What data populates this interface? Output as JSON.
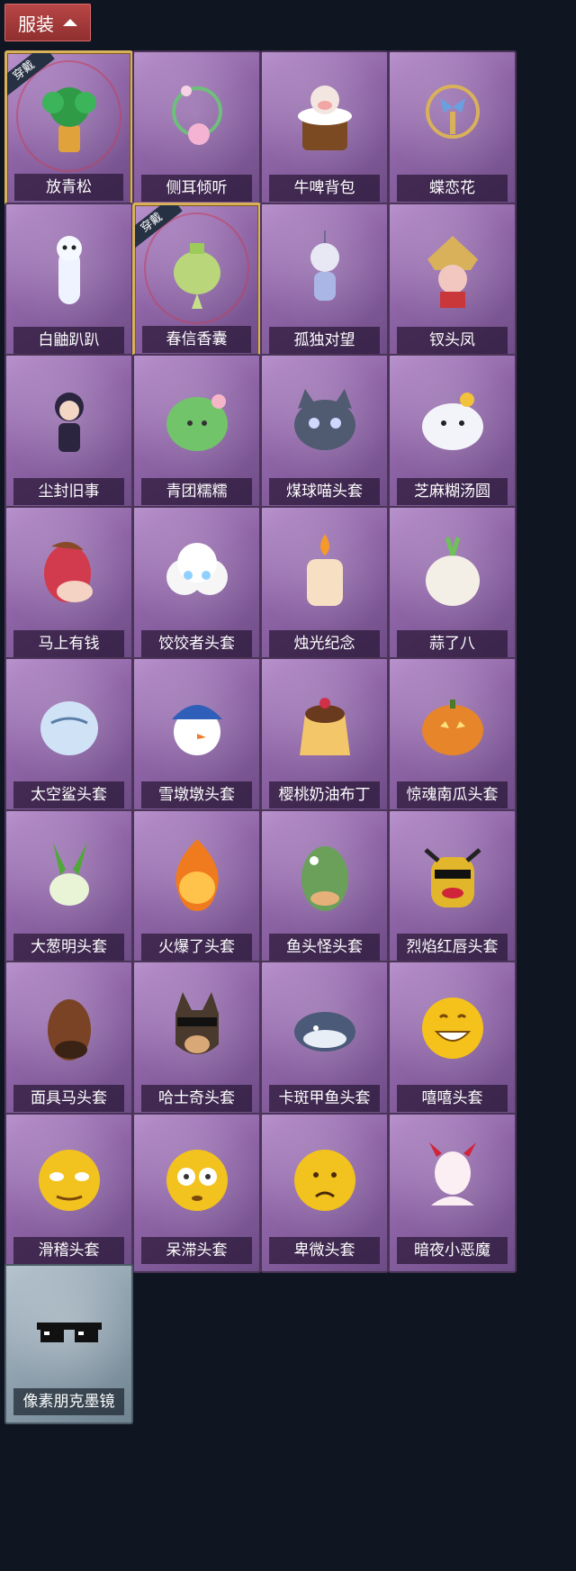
{
  "header": {
    "title": "服装"
  },
  "worn_tag_text": "穿戴",
  "items": [
    {
      "label": "放青松",
      "icon": "potted-pine-icon",
      "worn": true
    },
    {
      "label": "侧耳倾听",
      "icon": "floral-ear-ornament-icon",
      "worn": false
    },
    {
      "label": "牛啤背包",
      "icon": "cow-beer-backpack-icon",
      "worn": false
    },
    {
      "label": "蝶恋花",
      "icon": "butterfly-flower-ornament-icon",
      "worn": false
    },
    {
      "label": "白鼬趴趴",
      "icon": "white-ermine-icon",
      "worn": false
    },
    {
      "label": "春信香囊",
      "icon": "sachet-icon",
      "worn": true
    },
    {
      "label": "孤独对望",
      "icon": "doll-charm-icon",
      "worn": false
    },
    {
      "label": "钗头凤",
      "icon": "phoenix-crown-icon",
      "worn": false
    },
    {
      "label": "尘封旧事",
      "icon": "chibi-figure-icon",
      "worn": false
    },
    {
      "label": "青团糯糯",
      "icon": "green-rice-ball-icon",
      "worn": false
    },
    {
      "label": "煤球喵头套",
      "icon": "black-cat-head-icon",
      "worn": false
    },
    {
      "label": "芝麻糊汤圆",
      "icon": "dumpling-head-icon",
      "worn": false
    },
    {
      "label": "马上有钱",
      "icon": "red-horse-head-icon",
      "worn": false
    },
    {
      "label": "饺饺者头套",
      "icon": "cloud-dumpling-head-icon",
      "worn": false
    },
    {
      "label": "烛光纪念",
      "icon": "candle-head-icon",
      "worn": false
    },
    {
      "label": "蒜了八",
      "icon": "garlic-head-icon",
      "worn": false
    },
    {
      "label": "太空鲨头套",
      "icon": "shark-head-icon",
      "worn": false
    },
    {
      "label": "雪墩墩头套",
      "icon": "snowman-head-icon",
      "worn": false
    },
    {
      "label": "樱桃奶油布丁",
      "icon": "pudding-head-icon",
      "worn": false
    },
    {
      "label": "惊魂南瓜头套",
      "icon": "pumpkin-head-icon",
      "worn": false
    },
    {
      "label": "大葱明头套",
      "icon": "scallion-head-icon",
      "worn": false
    },
    {
      "label": "火爆了头套",
      "icon": "fire-head-icon",
      "worn": false
    },
    {
      "label": "鱼头怪头套",
      "icon": "fish-head-icon",
      "worn": false
    },
    {
      "label": "烈焰红唇头套",
      "icon": "red-lips-head-icon",
      "worn": false
    },
    {
      "label": "面具马头套",
      "icon": "horse-mask-icon",
      "worn": false
    },
    {
      "label": "哈士奇头套",
      "icon": "husky-head-icon",
      "worn": false
    },
    {
      "label": "卡斑甲鱼头套",
      "icon": "turtle-head-icon",
      "worn": false
    },
    {
      "label": "嘻嘻头套",
      "icon": "grin-emoji-head-icon",
      "worn": false
    },
    {
      "label": "滑稽头套",
      "icon": "funny-emoji-head-icon",
      "worn": false
    },
    {
      "label": "呆滞头套",
      "icon": "dazed-emoji-head-icon",
      "worn": false
    },
    {
      "label": "卑微头套",
      "icon": "humble-emoji-head-icon",
      "worn": false
    },
    {
      "label": "暗夜小恶魔",
      "icon": "little-devil-icon",
      "worn": false
    },
    {
      "label": "像素朋克墨镜",
      "icon": "pixel-sunglasses-icon",
      "worn": false,
      "grey": true
    }
  ],
  "colors": {
    "background": "#0f1622",
    "header_button": "#a53a3a",
    "card_purple": "#8e64a6",
    "worn_border": "#d8b15a"
  }
}
